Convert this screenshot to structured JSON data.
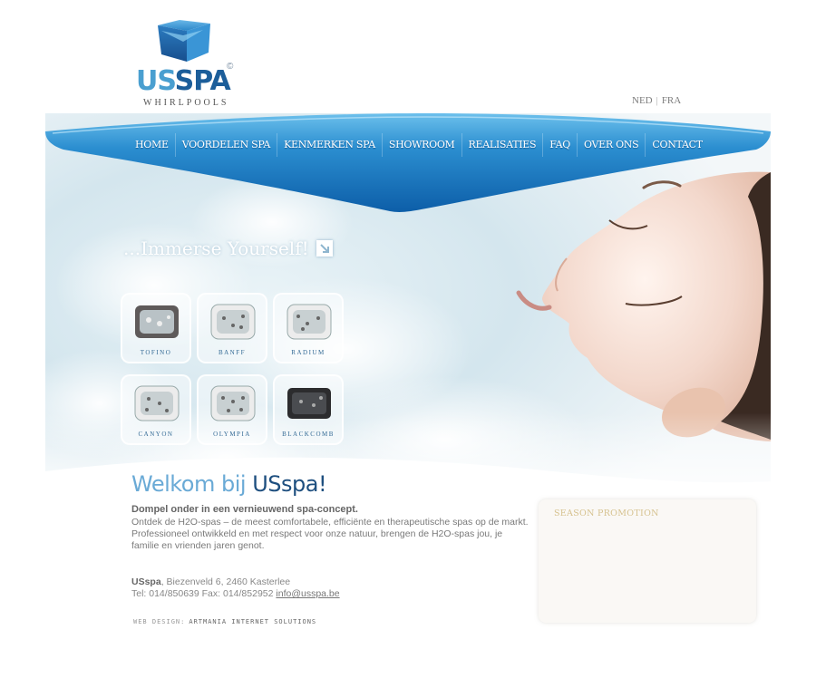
{
  "logo": {
    "us": "US",
    "spa": "SPA",
    "copyright": "©",
    "subtitle": "WHIRLPOOLS"
  },
  "lang": {
    "ned": "NED",
    "sep": "|",
    "fra": "FRA"
  },
  "nav": [
    {
      "label": "HOME"
    },
    {
      "label": "VOORDELEN SPA"
    },
    {
      "label": "KENMERKEN SPA"
    },
    {
      "label": "SHOWROOM"
    },
    {
      "label": "REALISATIES"
    },
    {
      "label": "FAQ"
    },
    {
      "label": "OVER ONS"
    },
    {
      "label": "CONTACT"
    }
  ],
  "hero": {
    "tagline": "...Immerse Yourself!"
  },
  "spas": [
    {
      "name": "TOFINO"
    },
    {
      "name": "BANFF"
    },
    {
      "name": "RADIUM"
    },
    {
      "name": "CANYON"
    },
    {
      "name": "OLYMPIA"
    },
    {
      "name": "BLACKCOMB"
    }
  ],
  "welcome": {
    "title_a": "Welkom bij ",
    "title_b": "USspa!",
    "lead": "Dompel onder in een vernieuwend spa-concept.",
    "body": "Ontdek de H2O-spas – de meest comfortabele, efficiënte en therapeutische spas op de markt. Professioneel ontwikkeld en met respect voor onze natuur, brengen de H2O-spas jou, je familie en vrienden jaren genot."
  },
  "contact": {
    "company": "USspa",
    "address": ", Biezenveld 6, 2460 Kasterlee",
    "phonefax": "Tel: 014/850639 Fax: 014/852952 ",
    "email": "info@usspa.be "
  },
  "credit": {
    "label": "WEB DESIGN:",
    "name": "ARTMANIA INTERNET SOLUTIONS"
  },
  "promo": {
    "title": "SEASON PROMOTION"
  }
}
